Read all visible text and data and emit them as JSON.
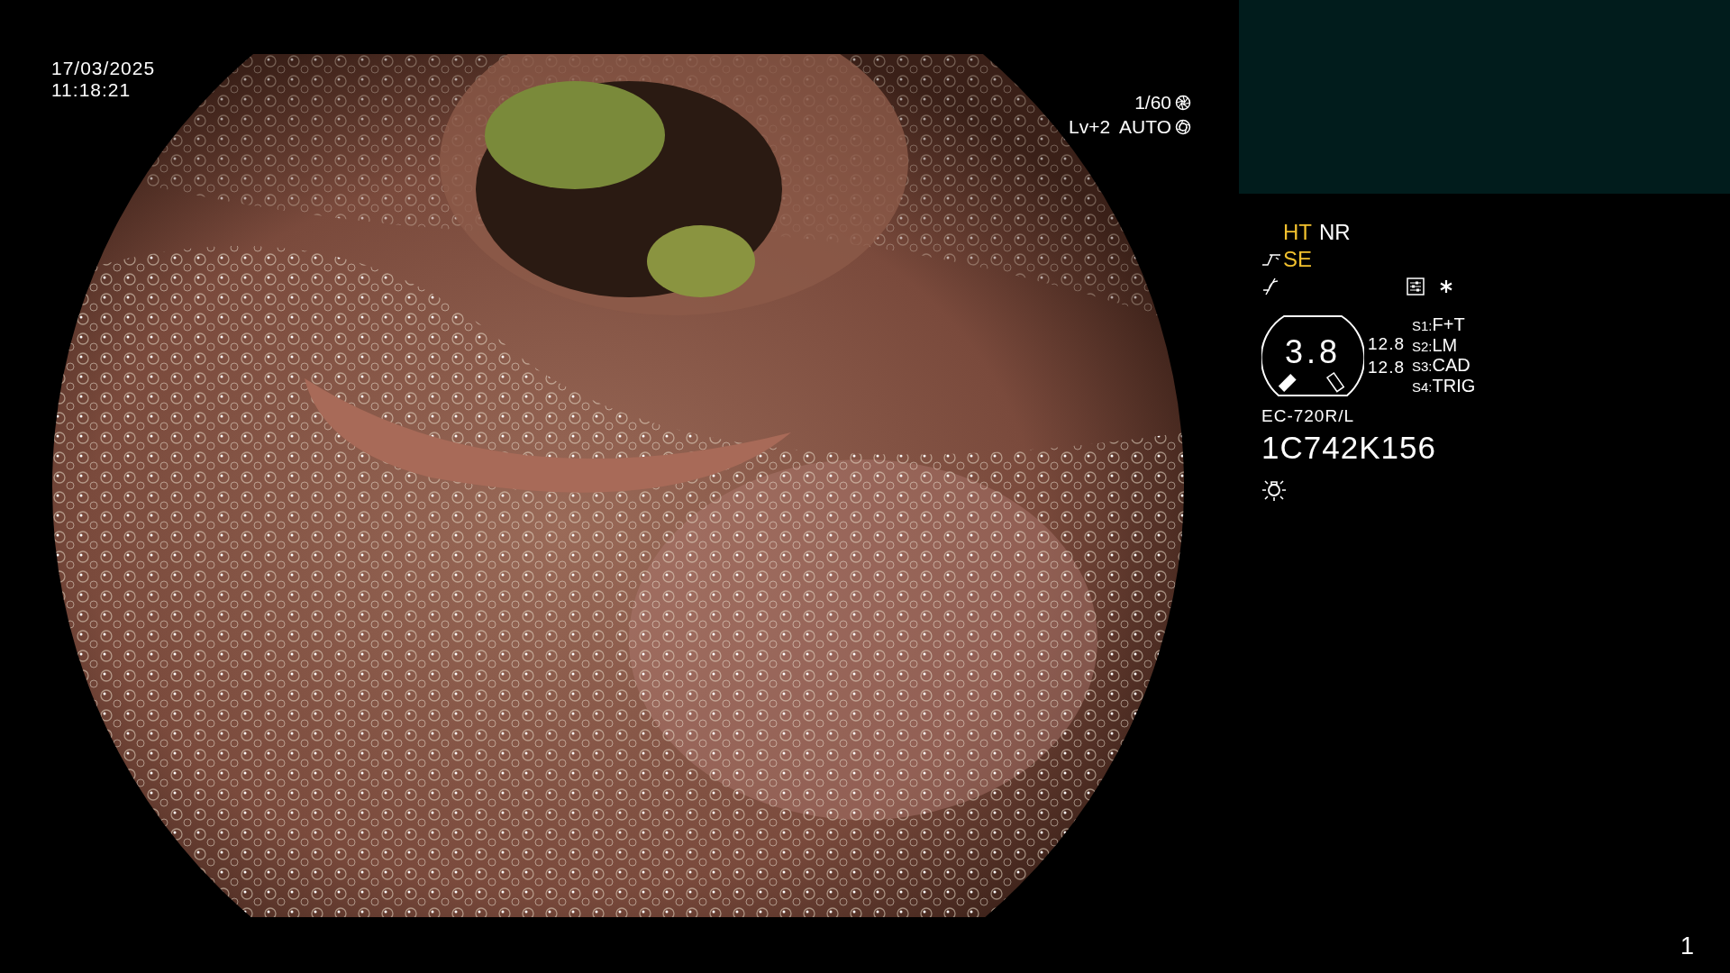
{
  "timestamp": {
    "date": "17/03/2025",
    "time": "11:18:21"
  },
  "exposure": {
    "shutter": "1/60",
    "level": "Lv+2",
    "mode": "AUTO"
  },
  "enhancements": [
    {
      "label": "HT",
      "active": true
    },
    {
      "label": "NR",
      "active": false
    }
  ],
  "structure": {
    "label": "SE",
    "active": true
  },
  "zoom_gauge": {
    "value": "3.8",
    "readings": [
      "12.8",
      "12.8"
    ]
  },
  "switches": [
    {
      "key": "S1:",
      "label": "F+T"
    },
    {
      "key": "S2:",
      "label": "LM"
    },
    {
      "key": "S3:",
      "label": "CAD"
    },
    {
      "key": "S4:",
      "label": "TRIG"
    }
  ],
  "scope": {
    "model": "EC-720R/L",
    "serial": "1C742K156"
  },
  "page_number": "1"
}
